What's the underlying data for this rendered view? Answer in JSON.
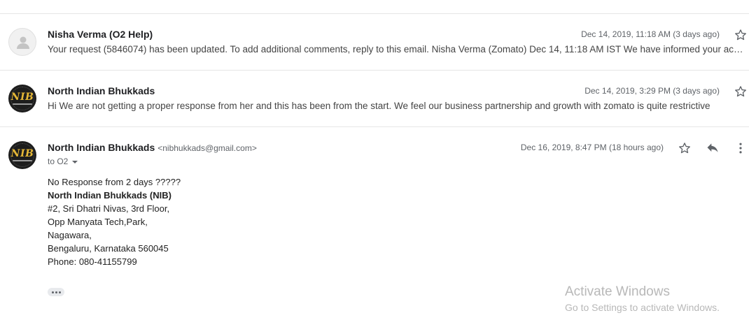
{
  "messages": [
    {
      "sender": "Nisha Verma (O2 Help)",
      "snippet": "Your request (5846074) has been updated. To add additional comments, reply to this email. Nisha Verma (Zomato) Dec 14, 11:18 AM IST We have informed your account manager about your concern and they will reach out to you shortly.",
      "date": "Dec 14, 2019, 11:18 AM (3 days ago)",
      "avatar_icon": "person-icon"
    },
    {
      "sender": "North Indian Bhukkads",
      "snippet": "Hi We are not getting a proper response from her and this has been from the start. We feel our business partnership and growth with zomato is quite restrictive",
      "date": "Dec 14, 2019, 3:29 PM (3 days ago)",
      "avatar_text": "NIB"
    },
    {
      "sender": "North Indian Bhukkads",
      "sender_email": "<nibhukkads@gmail.com>",
      "to": "to O2",
      "date": "Dec 16, 2019, 8:47 PM (18 hours ago)",
      "avatar_text": "NIB",
      "body": {
        "line1": "No Response from 2 days ?????",
        "org": "North Indian Bhukkads (NIB)",
        "addr1": "#2, Sri Dhatri Nivas, 3rd Floor,",
        "addr2": "Opp Manyata Tech,Park,",
        "addr3": "Nagawara,",
        "addr4": "Bengaluru, Karnataka 560045",
        "phone": "Phone: 080-41155799"
      }
    }
  ],
  "icons": {
    "star": "star-icon",
    "reply": "reply-icon",
    "more": "more-vert-icon",
    "trimmed": "show-trimmed-content-icon"
  },
  "watermark": {
    "title": "Activate Windows",
    "subtitle": "Go to Settings to activate Windows."
  }
}
